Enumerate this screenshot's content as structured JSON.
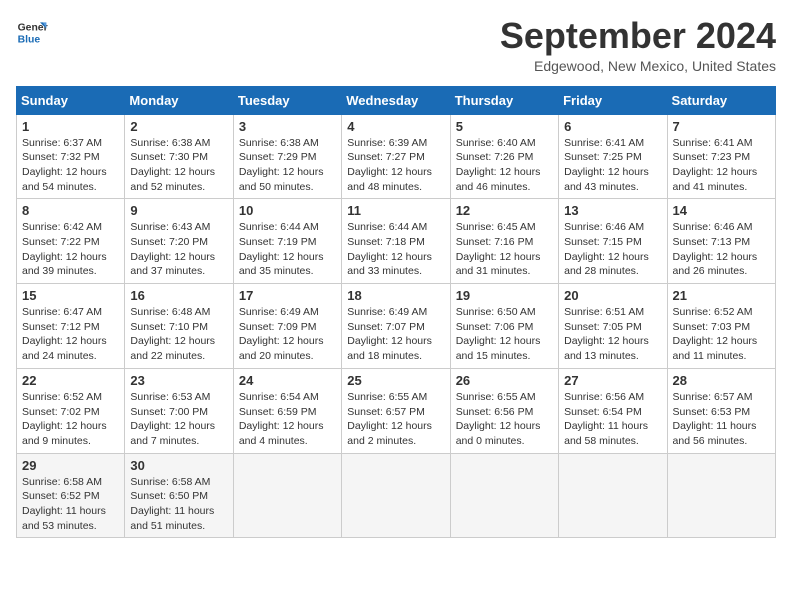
{
  "header": {
    "logo_line1": "General",
    "logo_line2": "Blue",
    "month_year": "September 2024",
    "location": "Edgewood, New Mexico, United States"
  },
  "columns": [
    "Sunday",
    "Monday",
    "Tuesday",
    "Wednesday",
    "Thursday",
    "Friday",
    "Saturday"
  ],
  "weeks": [
    [
      {
        "day": "1",
        "info": "Sunrise: 6:37 AM\nSunset: 7:32 PM\nDaylight: 12 hours\nand 54 minutes."
      },
      {
        "day": "2",
        "info": "Sunrise: 6:38 AM\nSunset: 7:30 PM\nDaylight: 12 hours\nand 52 minutes."
      },
      {
        "day": "3",
        "info": "Sunrise: 6:38 AM\nSunset: 7:29 PM\nDaylight: 12 hours\nand 50 minutes."
      },
      {
        "day": "4",
        "info": "Sunrise: 6:39 AM\nSunset: 7:27 PM\nDaylight: 12 hours\nand 48 minutes."
      },
      {
        "day": "5",
        "info": "Sunrise: 6:40 AM\nSunset: 7:26 PM\nDaylight: 12 hours\nand 46 minutes."
      },
      {
        "day": "6",
        "info": "Sunrise: 6:41 AM\nSunset: 7:25 PM\nDaylight: 12 hours\nand 43 minutes."
      },
      {
        "day": "7",
        "info": "Sunrise: 6:41 AM\nSunset: 7:23 PM\nDaylight: 12 hours\nand 41 minutes."
      }
    ],
    [
      {
        "day": "8",
        "info": "Sunrise: 6:42 AM\nSunset: 7:22 PM\nDaylight: 12 hours\nand 39 minutes."
      },
      {
        "day": "9",
        "info": "Sunrise: 6:43 AM\nSunset: 7:20 PM\nDaylight: 12 hours\nand 37 minutes."
      },
      {
        "day": "10",
        "info": "Sunrise: 6:44 AM\nSunset: 7:19 PM\nDaylight: 12 hours\nand 35 minutes."
      },
      {
        "day": "11",
        "info": "Sunrise: 6:44 AM\nSunset: 7:18 PM\nDaylight: 12 hours\nand 33 minutes."
      },
      {
        "day": "12",
        "info": "Sunrise: 6:45 AM\nSunset: 7:16 PM\nDaylight: 12 hours\nand 31 minutes."
      },
      {
        "day": "13",
        "info": "Sunrise: 6:46 AM\nSunset: 7:15 PM\nDaylight: 12 hours\nand 28 minutes."
      },
      {
        "day": "14",
        "info": "Sunrise: 6:46 AM\nSunset: 7:13 PM\nDaylight: 12 hours\nand 26 minutes."
      }
    ],
    [
      {
        "day": "15",
        "info": "Sunrise: 6:47 AM\nSunset: 7:12 PM\nDaylight: 12 hours\nand 24 minutes."
      },
      {
        "day": "16",
        "info": "Sunrise: 6:48 AM\nSunset: 7:10 PM\nDaylight: 12 hours\nand 22 minutes."
      },
      {
        "day": "17",
        "info": "Sunrise: 6:49 AM\nSunset: 7:09 PM\nDaylight: 12 hours\nand 20 minutes."
      },
      {
        "day": "18",
        "info": "Sunrise: 6:49 AM\nSunset: 7:07 PM\nDaylight: 12 hours\nand 18 minutes."
      },
      {
        "day": "19",
        "info": "Sunrise: 6:50 AM\nSunset: 7:06 PM\nDaylight: 12 hours\nand 15 minutes."
      },
      {
        "day": "20",
        "info": "Sunrise: 6:51 AM\nSunset: 7:05 PM\nDaylight: 12 hours\nand 13 minutes."
      },
      {
        "day": "21",
        "info": "Sunrise: 6:52 AM\nSunset: 7:03 PM\nDaylight: 12 hours\nand 11 minutes."
      }
    ],
    [
      {
        "day": "22",
        "info": "Sunrise: 6:52 AM\nSunset: 7:02 PM\nDaylight: 12 hours\nand 9 minutes."
      },
      {
        "day": "23",
        "info": "Sunrise: 6:53 AM\nSunset: 7:00 PM\nDaylight: 12 hours\nand 7 minutes."
      },
      {
        "day": "24",
        "info": "Sunrise: 6:54 AM\nSunset: 6:59 PM\nDaylight: 12 hours\nand 4 minutes."
      },
      {
        "day": "25",
        "info": "Sunrise: 6:55 AM\nSunset: 6:57 PM\nDaylight: 12 hours\nand 2 minutes."
      },
      {
        "day": "26",
        "info": "Sunrise: 6:55 AM\nSunset: 6:56 PM\nDaylight: 12 hours\nand 0 minutes."
      },
      {
        "day": "27",
        "info": "Sunrise: 6:56 AM\nSunset: 6:54 PM\nDaylight: 11 hours\nand 58 minutes."
      },
      {
        "day": "28",
        "info": "Sunrise: 6:57 AM\nSunset: 6:53 PM\nDaylight: 11 hours\nand 56 minutes."
      }
    ],
    [
      {
        "day": "29",
        "info": "Sunrise: 6:58 AM\nSunset: 6:52 PM\nDaylight: 11 hours\nand 53 minutes."
      },
      {
        "day": "30",
        "info": "Sunrise: 6:58 AM\nSunset: 6:50 PM\nDaylight: 11 hours\nand 51 minutes."
      },
      null,
      null,
      null,
      null,
      null
    ]
  ]
}
